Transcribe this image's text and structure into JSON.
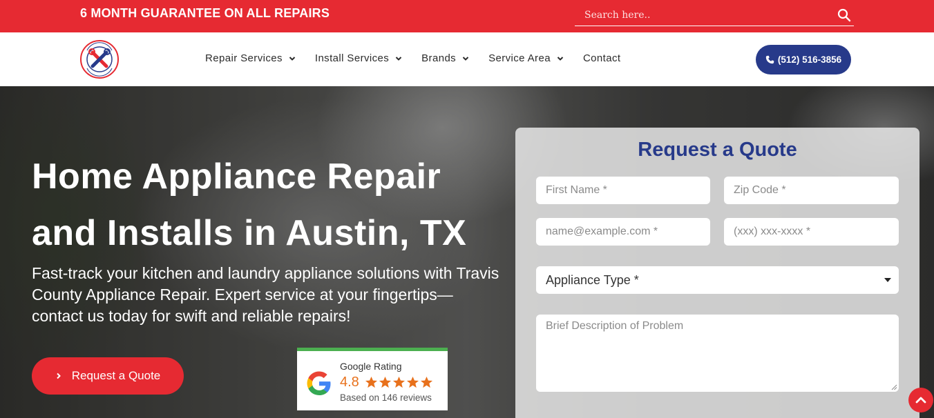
{
  "topbar": {
    "promo": "6 MONTH GUARANTEE ON ALL REPAIRS",
    "search_placeholder": "Search here.."
  },
  "nav": {
    "logo_alt": "Travis County Appliance Repair",
    "items": [
      {
        "label": "Repair Services",
        "has_dropdown": true
      },
      {
        "label": "Install Services",
        "has_dropdown": true
      },
      {
        "label": "Brands",
        "has_dropdown": true
      },
      {
        "label": "Service Area",
        "has_dropdown": true
      },
      {
        "label": "Contact",
        "has_dropdown": false
      }
    ],
    "phone": "(512) 516-3856"
  },
  "hero": {
    "title_line1": "Home Appliance Repair",
    "title_line2": "and Installs in Austin, TX",
    "subtitle": "Fast-track your kitchen and laundry appliance solutions with Travis County Appliance Repair. Expert service at your fingertips—contact us today for swift and reliable repairs!",
    "cta_label": "Request a Quote"
  },
  "rating": {
    "label": "Google Rating",
    "value": "4.8",
    "stars": 5,
    "count_text": "Based on 146 reviews"
  },
  "quote_form": {
    "title": "Request a Quote",
    "first_name_placeholder": "First Name *",
    "zip_placeholder": "Zip Code *",
    "email_placeholder": "name@example.com *",
    "phone_placeholder": "(xxx) xxx-xxxx *",
    "appliance_type_label": "Appliance Type *",
    "description_placeholder": "Brief Description of Problem"
  },
  "colors": {
    "brand_red": "#e62a32",
    "brand_blue": "#273a8a",
    "star_orange": "#e8711c",
    "rating_green": "#4caf50"
  }
}
